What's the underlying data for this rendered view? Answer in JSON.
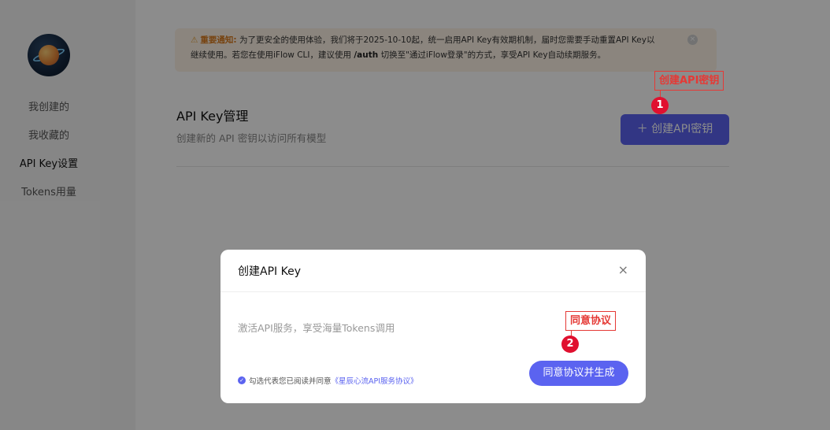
{
  "sidebar": {
    "items": [
      {
        "label": "我创建的"
      },
      {
        "label": "我收藏的"
      },
      {
        "label": "API Key设置"
      },
      {
        "label": "Tokens用量"
      }
    ]
  },
  "notice": {
    "label": "重要通知:",
    "text1": "为了更安全的使用体验，我们将于2025-10-10起，统一启用API Key有效期机制，届时您需要手动重置API Key以",
    "text2a": "继续使用。若您在使用iFlow CLI，建议使用 ",
    "code": "/auth",
    "text2b": " 切换至\"通过iFlow登录\"的方式，享受API Key自动续期服务。",
    "close_icon": "×"
  },
  "section": {
    "title": "API Key管理",
    "subtitle": "创建新的 API 密钥以访问所有模型",
    "create_button": "创建API密钥"
  },
  "modal": {
    "title": "创建API Key",
    "close_icon": "×",
    "description": "激活API服务，享受海量Tokens调用",
    "agree_prefix": "勾选代表您已阅读并同意",
    "agree_link": "《星辰心流API服务协议》",
    "agree_button": "同意协议并生成"
  },
  "annotations": [
    {
      "num": "1",
      "label": "创建API密钥"
    },
    {
      "num": "2",
      "label": "同意协议"
    }
  ],
  "colors": {
    "accent": "#5b63f0",
    "annotation": "#e53935"
  }
}
